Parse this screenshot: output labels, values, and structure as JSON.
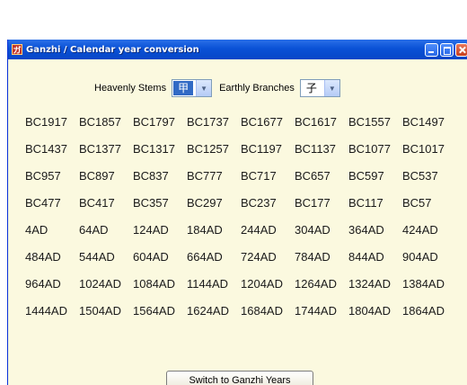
{
  "window": {
    "title": "Ganzhi / Calendar year conversion",
    "icon_glyph": "ガ"
  },
  "selectors": {
    "stems_label": "Heavenly Stems",
    "stems_value": "甲",
    "branches_label": "Earthly Branches",
    "branches_value": "子"
  },
  "years": [
    "BC1917",
    "BC1857",
    "BC1797",
    "BC1737",
    "BC1677",
    "BC1617",
    "BC1557",
    "BC1497",
    "BC1437",
    "BC1377",
    "BC1317",
    "BC1257",
    "BC1197",
    "BC1137",
    "BC1077",
    "BC1017",
    "BC957",
    "BC897",
    "BC837",
    "BC777",
    "BC717",
    "BC657",
    "BC597",
    "BC537",
    "BC477",
    "BC417",
    "BC357",
    "BC297",
    "BC237",
    "BC177",
    "BC117",
    "BC57",
    "4AD",
    "64AD",
    "124AD",
    "184AD",
    "244AD",
    "304AD",
    "364AD",
    "424AD",
    "484AD",
    "544AD",
    "604AD",
    "664AD",
    "724AD",
    "784AD",
    "844AD",
    "904AD",
    "964AD",
    "1024AD",
    "1084AD",
    "1144AD",
    "1204AD",
    "1264AD",
    "1324AD",
    "1384AD",
    "1444AD",
    "1504AD",
    "1564AD",
    "1624AD",
    "1684AD",
    "1744AD",
    "1804AD",
    "1864AD"
  ],
  "switch_button": "Switch to Ganzhi Years"
}
